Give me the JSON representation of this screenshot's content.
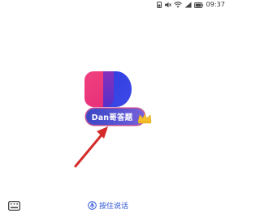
{
  "status_bar": {
    "time": "09:37",
    "icons": [
      "battery-saver-icon",
      "mute-icon",
      "wifi-icon",
      "signal-icon",
      "battery-icon"
    ]
  },
  "app": {
    "name_badge": "Dan哥答题",
    "logo_icon": "app-logo-icon",
    "badge_decoration_icon": "crown-icon"
  },
  "bottom_bar": {
    "keyboard_icon": "keyboard-icon",
    "voice_icon": "microphone-icon",
    "voice_label": "按住说话"
  },
  "annotation": {
    "type": "arrow",
    "color": "#d42a2a"
  },
  "colors": {
    "accent": "#2f56d8",
    "badge_start": "#3b46c4",
    "badge_end": "#7a60d8",
    "badge_outline": "#c44a8e",
    "logo_pink": "#f23a7a",
    "logo_blue": "#3b3fe0"
  }
}
